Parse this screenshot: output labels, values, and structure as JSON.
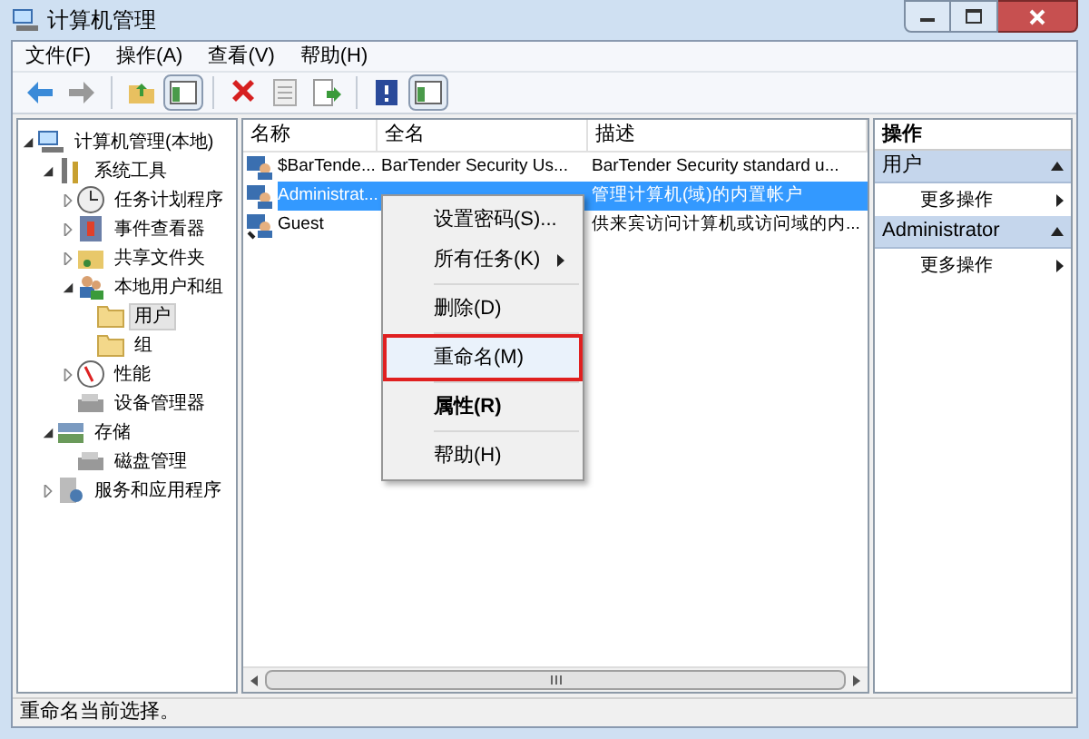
{
  "window": {
    "title": "计算机管理"
  },
  "menu": [
    "文件(F)",
    "操作(A)",
    "查看(V)",
    "帮助(H)"
  ],
  "toolbar": [
    {
      "kind": "back"
    },
    {
      "kind": "forward"
    },
    {
      "kind": "sep"
    },
    {
      "kind": "up"
    },
    {
      "kind": "panel",
      "selected": true
    },
    {
      "kind": "sep"
    },
    {
      "kind": "delete"
    },
    {
      "kind": "properties"
    },
    {
      "kind": "export"
    },
    {
      "kind": "sep"
    },
    {
      "kind": "help"
    },
    {
      "kind": "panel",
      "selected": true
    }
  ],
  "tree": [
    {
      "label": "计算机管理(本地)",
      "kind": "computer",
      "expanded": true,
      "selected": false,
      "children": [
        {
          "label": "系统工具",
          "kind": "tools",
          "expanded": true,
          "selected": false,
          "children": [
            {
              "label": "任务计划程序",
              "kind": "clock",
              "expanded": false,
              "selected": false
            },
            {
              "label": "事件查看器",
              "kind": "event",
              "expanded": false,
              "selected": false
            },
            {
              "label": "共享文件夹",
              "kind": "share",
              "expanded": false,
              "selected": false
            },
            {
              "label": "本地用户和组",
              "kind": "users",
              "expanded": true,
              "selected": false,
              "children": [
                {
                  "label": "用户",
                  "kind": "folder",
                  "selected": true
                },
                {
                  "label": "组",
                  "kind": "folder",
                  "selected": false
                }
              ]
            },
            {
              "label": "性能",
              "kind": "perf",
              "expanded": false,
              "selected": false
            },
            {
              "label": "设备管理器",
              "kind": "device",
              "selected": false
            }
          ]
        },
        {
          "label": "存储",
          "kind": "storage",
          "expanded": true,
          "selected": false,
          "children": [
            {
              "label": "磁盘管理",
              "kind": "device",
              "selected": false
            }
          ]
        },
        {
          "label": "服务和应用程序",
          "kind": "services",
          "expanded": false,
          "selected": false
        }
      ]
    }
  ],
  "table": {
    "columns": [
      "名称",
      "全名",
      "描述"
    ],
    "rows": [
      {
        "cells": [
          "$BarTende...",
          "BarTender Security Us...",
          "BarTender Security standard u..."
        ],
        "selected": false,
        "disabled": false
      },
      {
        "cells": [
          "Administrat...",
          "",
          "管理计算机(域)的内置帐户"
        ],
        "selected": true,
        "disabled": false
      },
      {
        "cells": [
          "Guest",
          "",
          "供来宾访问计算机或访问域的内..."
        ],
        "selected": false,
        "disabled": true
      }
    ]
  },
  "context_menu": [
    {
      "kind": "item",
      "label": "设置密码(S)...",
      "highlighted": false,
      "bold": false,
      "submenu": false
    },
    {
      "kind": "item",
      "label": "所有任务(K)",
      "highlighted": false,
      "bold": false,
      "submenu": true
    },
    {
      "kind": "separator"
    },
    {
      "kind": "item",
      "label": "删除(D)",
      "highlighted": false,
      "bold": false,
      "submenu": false
    },
    {
      "kind": "separator"
    },
    {
      "kind": "item",
      "label": "重命名(M)",
      "highlighted": true,
      "bold": false,
      "submenu": false
    },
    {
      "kind": "separator"
    },
    {
      "kind": "item",
      "label": "属性(R)",
      "highlighted": false,
      "bold": true,
      "submenu": false
    },
    {
      "kind": "separator"
    },
    {
      "kind": "item",
      "label": "帮助(H)",
      "highlighted": false,
      "bold": false,
      "submenu": false
    }
  ],
  "actions": {
    "title": "操作",
    "sections": [
      {
        "title": "用户",
        "items": [
          "更多操作"
        ]
      },
      {
        "title": "Administrator",
        "items": [
          "更多操作"
        ]
      }
    ]
  },
  "status_bar": "重命名当前选择。"
}
